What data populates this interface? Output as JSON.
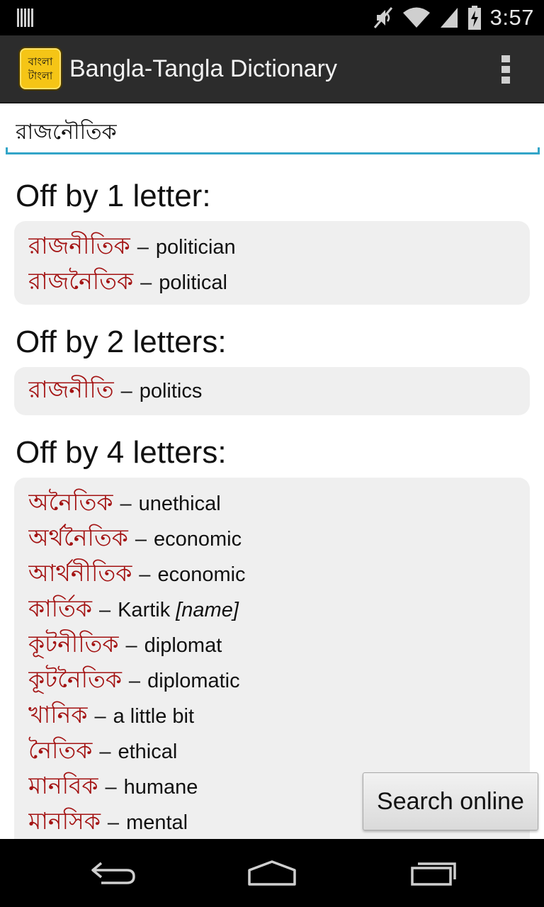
{
  "status_bar": {
    "time": "3:57",
    "icons": [
      "notification-icon",
      "mute-icon",
      "wifi-icon",
      "signal-icon",
      "battery-charging-icon"
    ]
  },
  "action_bar": {
    "app_icon_lines": [
      "বাংলা",
      "টাংলা"
    ],
    "title": "Bangla-Tangla Dictionary",
    "overflow_icon": "overflow-menu-icon"
  },
  "search": {
    "value": "রাজনৌতিক"
  },
  "sections": [
    {
      "title": "Off by 1 letter:",
      "entries": [
        {
          "bn": "রাজনীতিক",
          "en": "politician"
        },
        {
          "bn": "রাজনৈতিক",
          "en": "political"
        }
      ]
    },
    {
      "title": "Off by 2 letters:",
      "entries": [
        {
          "bn": "রাজনীতি",
          "en": "politics"
        }
      ]
    },
    {
      "title": "Off by 4 letters:",
      "entries": [
        {
          "bn": "অনৈতিক",
          "en": "unethical"
        },
        {
          "bn": "অর্থনৈতিক",
          "en": "economic"
        },
        {
          "bn": "আর্থনীতিক",
          "en": "economic"
        },
        {
          "bn": "কার্তিক",
          "en": "Kartik",
          "note": "[name]"
        },
        {
          "bn": "কূটনীতিক",
          "en": "diplomat"
        },
        {
          "bn": "কূটনৈতিক",
          "en": "diplomatic"
        },
        {
          "bn": "খানিক",
          "en": "a little bit"
        },
        {
          "bn": "নৈতিক",
          "en": "ethical"
        },
        {
          "bn": "মানবিক",
          "en": "humane"
        },
        {
          "bn": "মানসিক",
          "en": "mental"
        }
      ]
    }
  ],
  "dash": "–",
  "search_online_label": "Search online",
  "nav_bar": {
    "icons": [
      "back-icon",
      "home-icon",
      "recent-apps-icon"
    ]
  },
  "colors": {
    "bangla_word": "#a31212",
    "input_underline": "#33a5c8",
    "card_background": "#efefef",
    "action_bar": "#2c2c2c",
    "app_icon": "#f5c516"
  }
}
